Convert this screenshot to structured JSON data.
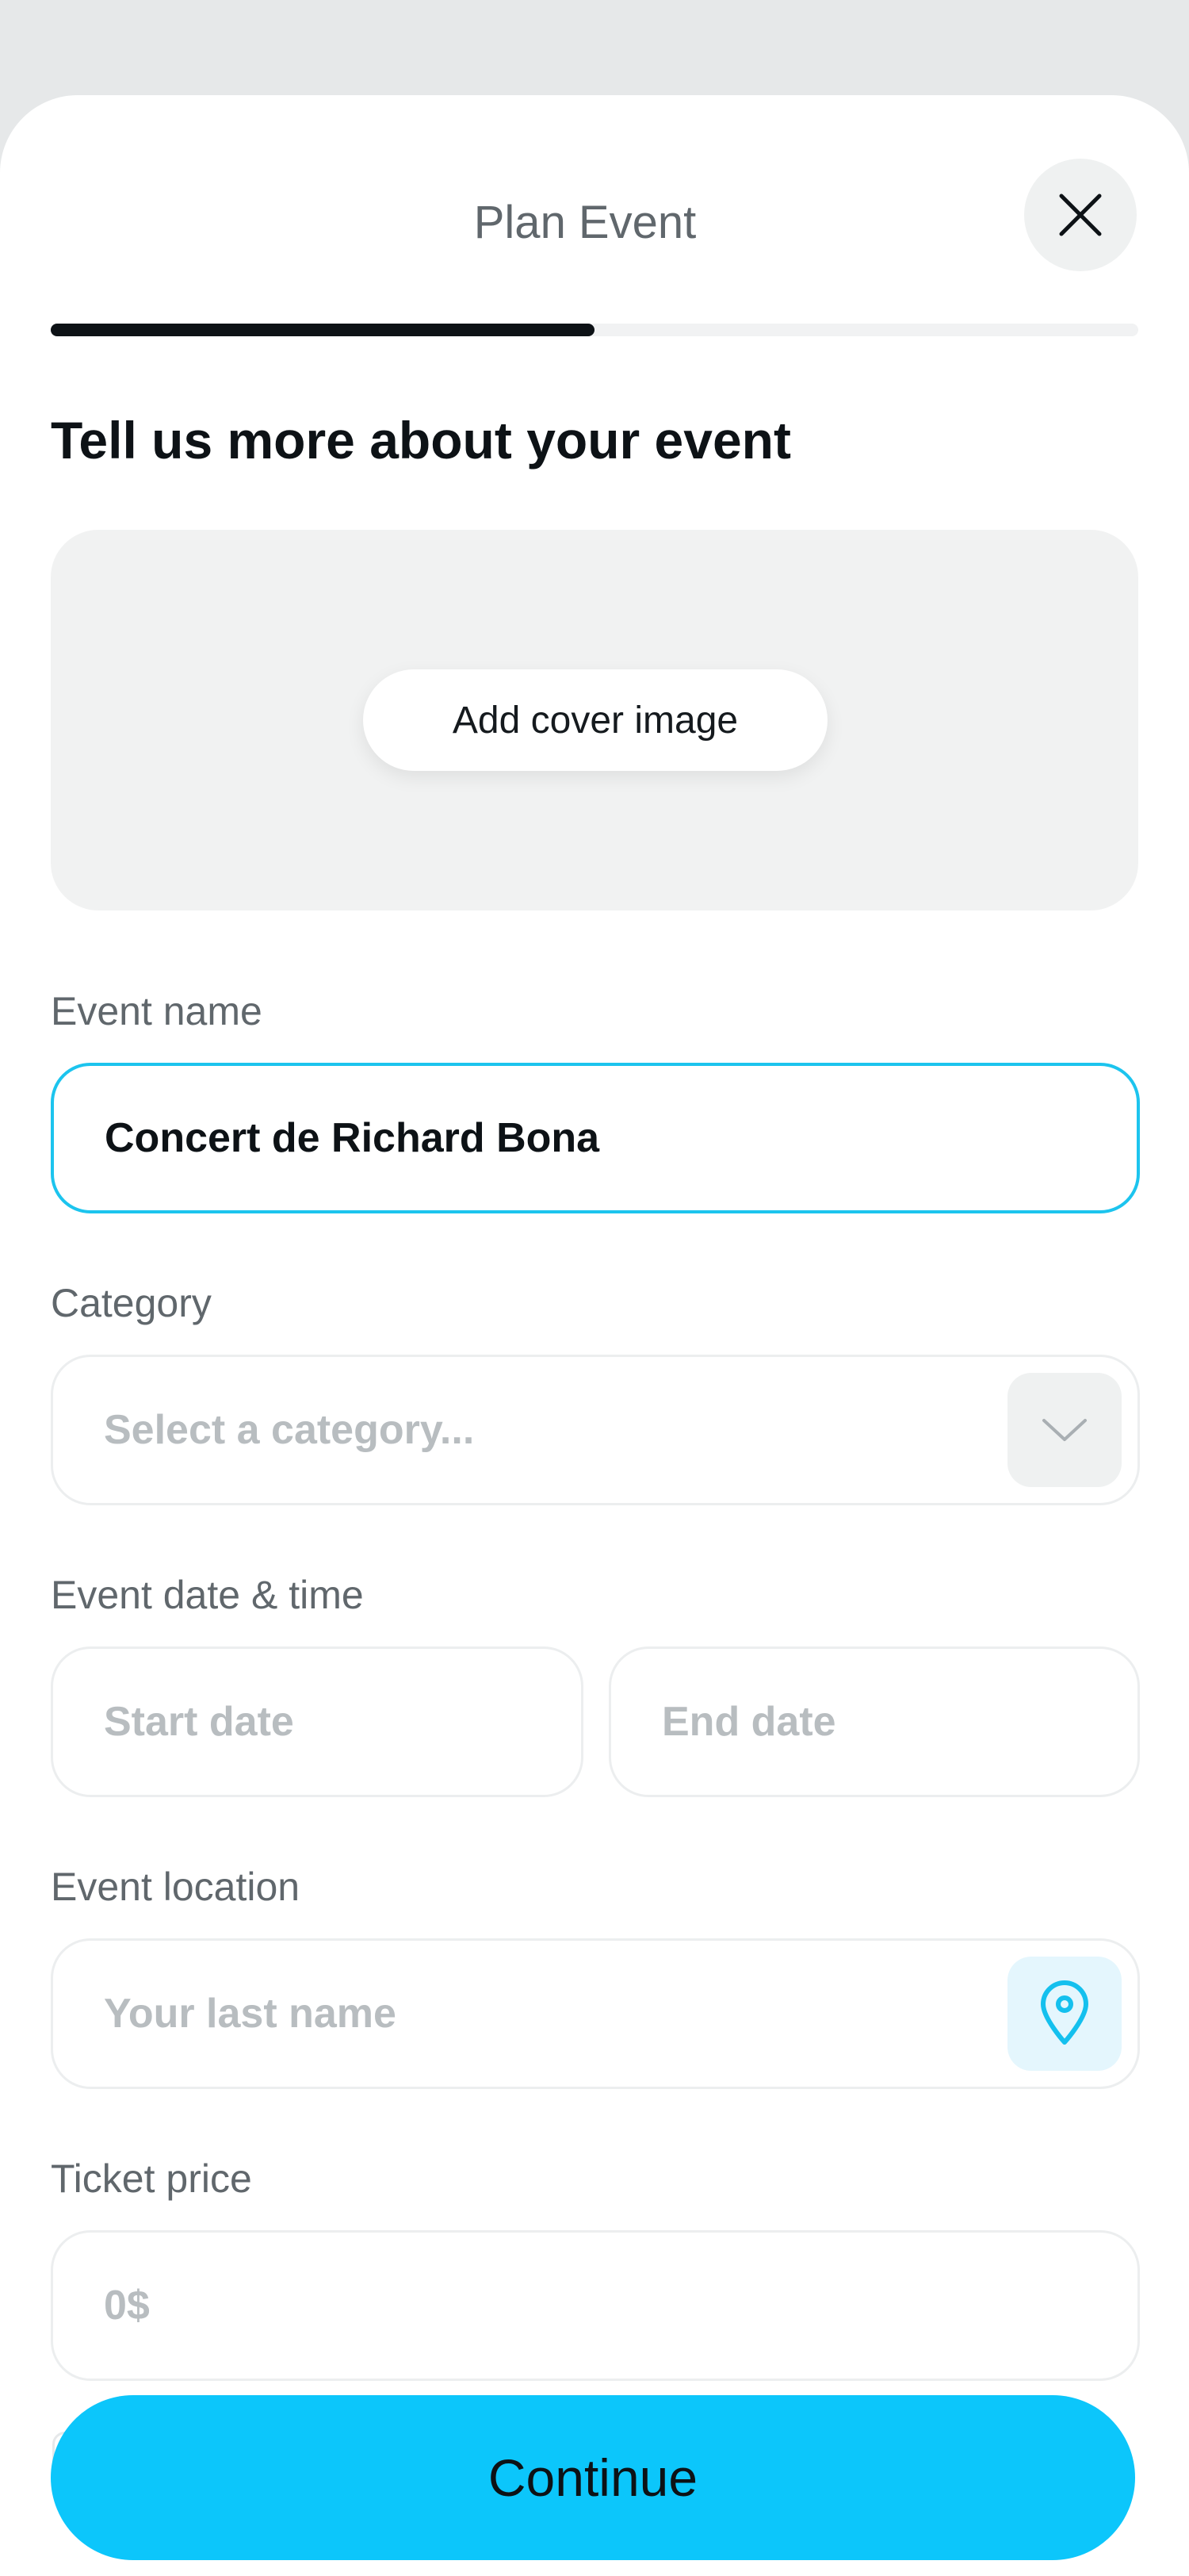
{
  "header": {
    "title": "Plan Event",
    "close_icon": "close-icon"
  },
  "progress": {
    "fraction": 0.5
  },
  "heading": "Tell us more about your event",
  "cover": {
    "button_label": "Add cover image"
  },
  "fields": {
    "event_name": {
      "label": "Event name",
      "value": "Concert de Richard Bona"
    },
    "category": {
      "label": "Category",
      "placeholder": "Select a category...",
      "icon": "chevron-down-icon"
    },
    "datetime": {
      "label": "Event date & time",
      "start_placeholder": "Start date",
      "end_placeholder": "End date"
    },
    "location": {
      "label": "Event location",
      "placeholder": "Your last name",
      "icon": "location-pin-icon"
    },
    "price": {
      "label": "Ticket price",
      "placeholder": "0$"
    }
  },
  "footer": {
    "continue_label": "Continue"
  },
  "colors": {
    "accent": "#0cc6fb",
    "input_focus": "#1cc4ee",
    "text": "#0d1216",
    "muted": "#60676c"
  }
}
